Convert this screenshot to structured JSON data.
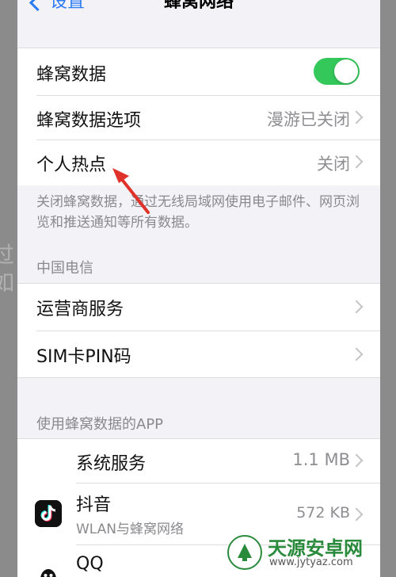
{
  "nav": {
    "back_label": "设置",
    "title": "蜂窝网络"
  },
  "cellular": {
    "data_label": "蜂窝数据",
    "data_enabled": true,
    "options_label": "蜂窝数据选项",
    "options_value": "漫游已关闭",
    "hotspot_label": "个人热点",
    "hotspot_value": "关闭"
  },
  "footnote": "关闭蜂窝数据，通过无线局域网使用电子邮件、网页浏览和推送通知等所有数据。",
  "carrier": {
    "header": "中国电信",
    "services_label": "运营商服务",
    "sim_pin_label": "SIM卡PIN码"
  },
  "apps": {
    "header": "使用蜂窝数据的APP",
    "items": [
      {
        "name": "系统服务",
        "size": "1.1 MB",
        "icon": "none"
      },
      {
        "name": "抖音",
        "subtitle": "WLAN与蜂窝网络",
        "size": "572 KB",
        "icon": "tiktok-icon"
      },
      {
        "name": "QQ",
        "icon": "qq-icon"
      }
    ]
  },
  "annotation": {
    "arrow_color": "#e0322b"
  },
  "colors": {
    "toggle_on": "#34c759",
    "link_blue": "#2b7cf6",
    "background": "#f2f2f7"
  }
}
